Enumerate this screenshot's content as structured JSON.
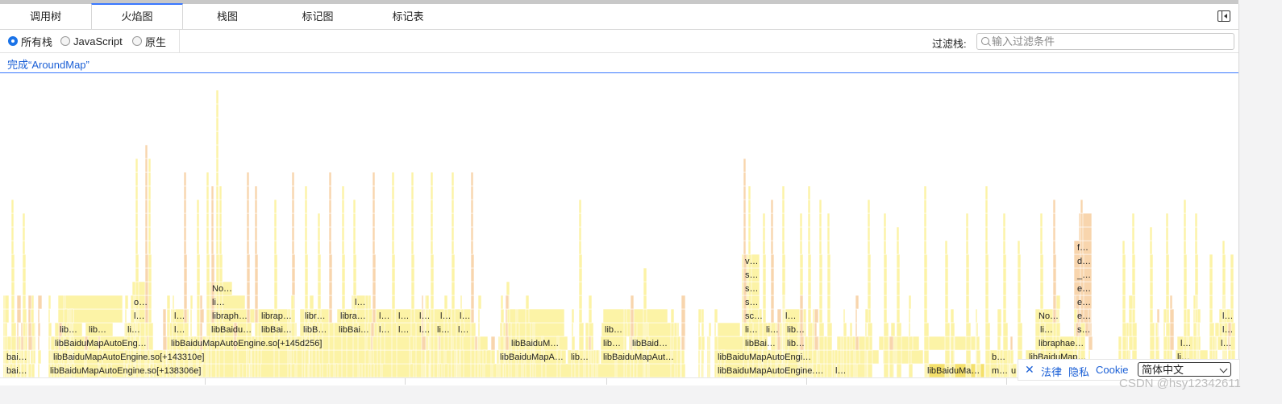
{
  "tabs": [
    {
      "label": "调用树",
      "active": false
    },
    {
      "label": "火焰图",
      "active": true
    },
    {
      "label": "栈图",
      "active": false
    },
    {
      "label": "标记图",
      "active": false
    },
    {
      "label": "标记表",
      "active": false
    }
  ],
  "stack_filter": {
    "options": [
      {
        "label": "所有栈",
        "selected": true
      },
      {
        "label": "JavaScript",
        "selected": false
      },
      {
        "label": "原生",
        "selected": false
      }
    ]
  },
  "filter": {
    "label": "过滤栈:",
    "placeholder": "输入过滤条件",
    "value": ""
  },
  "breadcrumb": "完成“AroundMap”",
  "colors": {
    "frame_native": "#fcf3a6",
    "frame_js": "#f8d5ad",
    "frame_selected": "#f4e06b",
    "accent": "#1a73e8",
    "link": "#1a5fd6"
  },
  "flame_labels": [
    {
      "text": "bai…",
      "row": 0
    },
    {
      "text": "libBaiduMapAutoEngine.so[+138306e]",
      "row": 0
    },
    {
      "text": "libBaiduMapAutoEngine.…",
      "row": 0
    },
    {
      "text": "l…",
      "row": 0
    },
    {
      "text": "libBaiduMa…",
      "row": 0
    },
    {
      "text": "m…",
      "row": 0
    },
    {
      "text": "u",
      "row": 0
    },
    {
      "text": "bai…",
      "row": 1
    },
    {
      "text": "libBaiduMapAutoEngine.so[+143310e]",
      "row": 1
    },
    {
      "text": "libBaiduMapA…",
      "row": 1
    },
    {
      "text": "lib…",
      "row": 1
    },
    {
      "text": "libBaiduMapAut…",
      "row": 1
    },
    {
      "text": "libBaiduMapAutoEngi…",
      "row": 1
    },
    {
      "text": "b…",
      "row": 1
    },
    {
      "text": "libBaiduMap…",
      "row": 1
    },
    {
      "text": "li…",
      "row": 1
    },
    {
      "text": "libBaiduMapAutoEng…",
      "row": 2
    },
    {
      "text": "libBaiduMapAutoEngine.so[+145d256]",
      "row": 2
    },
    {
      "text": "libBaiduM…",
      "row": 2
    },
    {
      "text": "lib…",
      "row": 2
    },
    {
      "text": "libBaid…",
      "row": 2
    },
    {
      "text": "libBai…",
      "row": 2
    },
    {
      "text": "lib…",
      "row": 2
    },
    {
      "text": "libraphae…",
      "row": 2
    },
    {
      "text": "l…",
      "row": 2
    },
    {
      "text": "l…",
      "row": 2
    },
    {
      "text": "lib…",
      "row": 3
    },
    {
      "text": "lib…",
      "row": 3
    },
    {
      "text": "li…",
      "row": 3
    },
    {
      "text": "l…",
      "row": 3
    },
    {
      "text": "libBaidu…",
      "row": 3
    },
    {
      "text": "libBai…",
      "row": 3
    },
    {
      "text": "libB…",
      "row": 3
    },
    {
      "text": "libBai…",
      "row": 3
    },
    {
      "text": "l…",
      "row": 3
    },
    {
      "text": "l…",
      "row": 3
    },
    {
      "text": "l…",
      "row": 3
    },
    {
      "text": "li…",
      "row": 3
    },
    {
      "text": "l…",
      "row": 3
    },
    {
      "text": "lib…",
      "row": 3
    },
    {
      "text": "li…",
      "row": 3
    },
    {
      "text": "li…",
      "row": 3
    },
    {
      "text": "lib…",
      "row": 3
    },
    {
      "text": "li…",
      "row": 3
    },
    {
      "text": "s…",
      "row": 3
    },
    {
      "text": "l…",
      "row": 3
    },
    {
      "text": "l…",
      "row": 4
    },
    {
      "text": "l…",
      "row": 4
    },
    {
      "text": "libraph…",
      "row": 4
    },
    {
      "text": "librap…",
      "row": 4
    },
    {
      "text": "libr…",
      "row": 4
    },
    {
      "text": "libra…",
      "row": 4
    },
    {
      "text": "l…",
      "row": 4
    },
    {
      "text": "l…",
      "row": 4
    },
    {
      "text": "l…",
      "row": 4
    },
    {
      "text": "l…",
      "row": 4
    },
    {
      "text": "l…",
      "row": 4
    },
    {
      "text": "sc…",
      "row": 4
    },
    {
      "text": "l…",
      "row": 4
    },
    {
      "text": "No…",
      "row": 4
    },
    {
      "text": "e…",
      "row": 4
    },
    {
      "text": "l…",
      "row": 4
    },
    {
      "text": "o…",
      "row": 5
    },
    {
      "text": "li…",
      "row": 5
    },
    {
      "text": "l…",
      "row": 5
    },
    {
      "text": "s…",
      "row": 5
    },
    {
      "text": "e…",
      "row": 5
    },
    {
      "text": "No…",
      "row": 6
    },
    {
      "text": "s…",
      "row": 6
    },
    {
      "text": "e…",
      "row": 6
    },
    {
      "text": "s…",
      "row": 7
    },
    {
      "text": "_…",
      "row": 7
    },
    {
      "text": "v…",
      "row": 8
    },
    {
      "text": "d…",
      "row": 8
    },
    {
      "text": "f…",
      "row": 9
    }
  ],
  "footer": {
    "close_label": "✕",
    "links": [
      "法律",
      "隐私",
      "Cookie"
    ],
    "language": "简体中文"
  },
  "watermark": "CSDN @hsy12342611"
}
